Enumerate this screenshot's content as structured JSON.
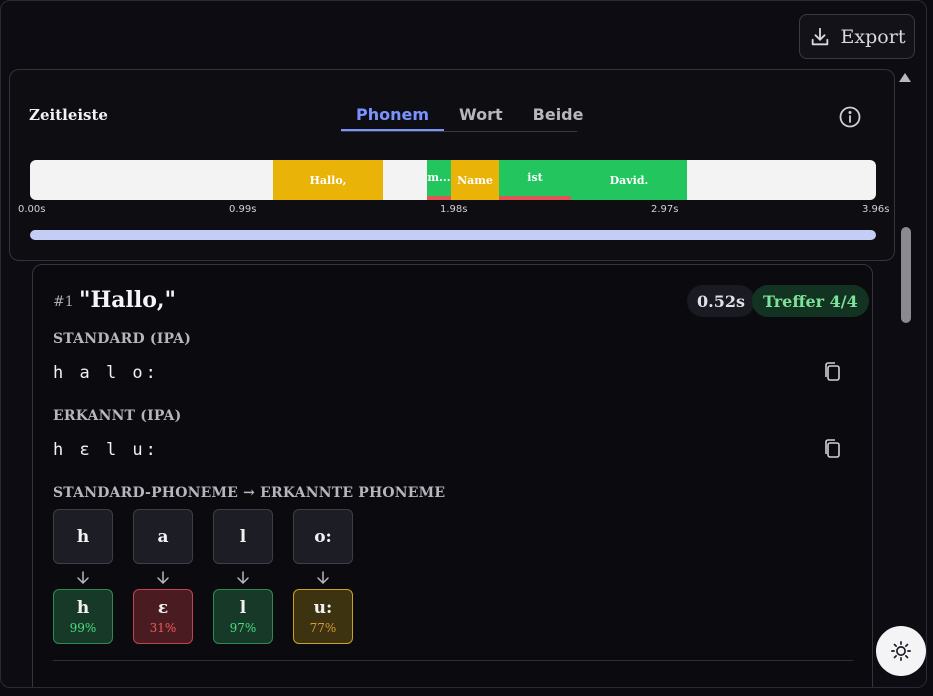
{
  "header": {
    "export_label": "Export",
    "export_icon": "download-icon"
  },
  "timeline": {
    "title": "Zeitleiste",
    "tabs": [
      {
        "label": "Phonem",
        "active": true
      },
      {
        "label": "Wort",
        "active": false
      },
      {
        "label": "Beide",
        "active": false
      }
    ],
    "info_icon": "info-icon",
    "segments": [
      {
        "label": "Hallo,",
        "color": "#eab308",
        "error": false
      },
      {
        "label": "m...",
        "color": "#22c55e",
        "error": true
      },
      {
        "label": "Name",
        "color": "#eab308",
        "error": false
      },
      {
        "label": "ist",
        "color": "#22c55e",
        "error": true
      },
      {
        "label": "David.",
        "color": "#22c55e",
        "error": false
      }
    ],
    "ticks": [
      "0.00s",
      "0.99s",
      "1.98s",
      "2.97s",
      "3.96s"
    ]
  },
  "card": {
    "index": "#1",
    "word": "\"Hallo,\"",
    "duration": "0.52s",
    "hits": "Treffer 4/4",
    "standard_label": "STANDARD (IPA)",
    "standard_ipa": "h a l o:",
    "detected_label": "ERKANNT (IPA)",
    "detected_ipa": "h ɛ l u:",
    "mapping_label": "STANDARD-PHONEME → ERKANNTE PHONEME",
    "standard_phonemes": [
      "h",
      "a",
      "l",
      "o:"
    ],
    "detected_phonemes": [
      {
        "phoneme": "h",
        "confidence": "99%",
        "status": "match",
        "bg": "#173a28",
        "border": "#2f8a4e",
        "pct_color": "#4ade80"
      },
      {
        "phoneme": "ɛ",
        "confidence": "31%",
        "status": "mismatch",
        "bg": "#4a1c22",
        "border": "#c2424d",
        "pct_color": "#f05a5a"
      },
      {
        "phoneme": "l",
        "confidence": "97%",
        "status": "match",
        "bg": "#173a28",
        "border": "#2f8a4e",
        "pct_color": "#4ade80"
      },
      {
        "phoneme": "u:",
        "confidence": "77%",
        "status": "partial",
        "bg": "#3d3310",
        "border": "#caa224",
        "pct_color": "#d79a35"
      }
    ]
  },
  "theme_icon": "sun-icon"
}
